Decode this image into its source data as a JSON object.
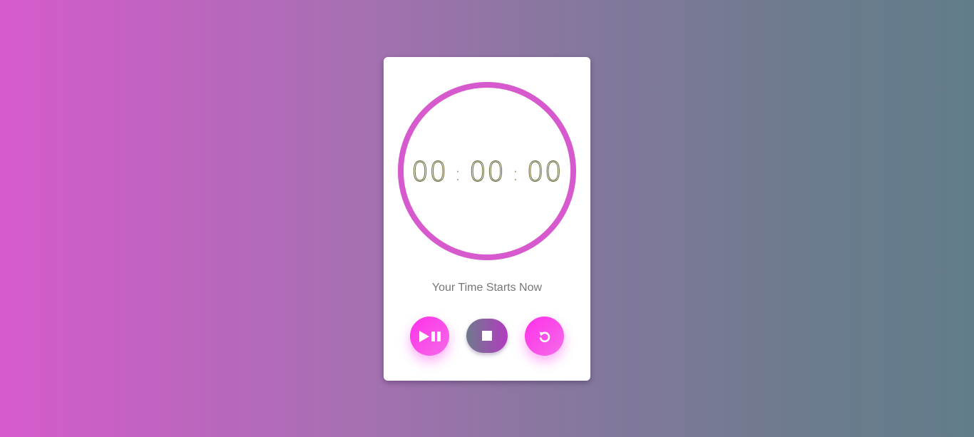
{
  "timer": {
    "hours": "00",
    "minutes": "00",
    "seconds": "00",
    "separator": ":"
  },
  "status_text": "Your Time Starts Now",
  "controls": {
    "play_pause_icon": "play-pause-icon",
    "stop_icon": "stop-icon",
    "reset_icon": "reset-icon"
  },
  "colors": {
    "accent": "#d65acd",
    "button_gradient_start": "#ff2fe9",
    "button_gradient_end": "#f46ce9",
    "bg_left": "#d65acd",
    "bg_right": "#627d8a"
  }
}
